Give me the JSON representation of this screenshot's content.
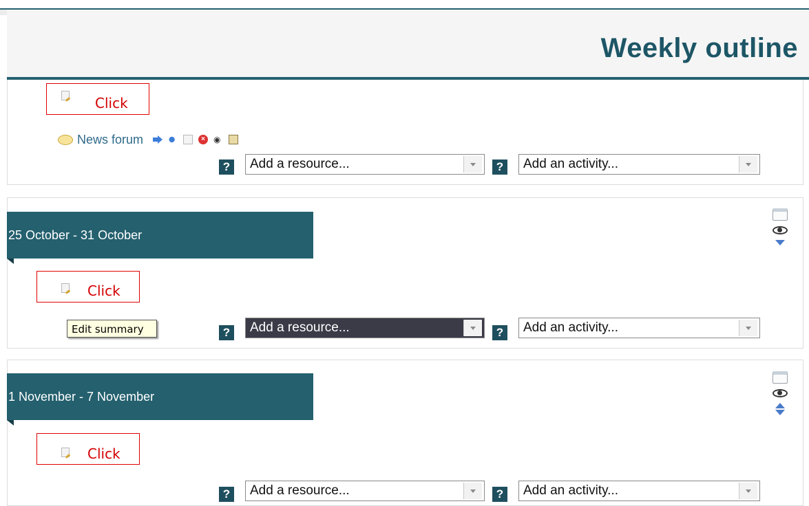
{
  "page": {
    "title": "Weekly outline"
  },
  "click_label": "Click",
  "news": {
    "label": "News forum"
  },
  "controls": {
    "help_symbol": "?",
    "resource_placeholder": "Add a resource...",
    "activity_placeholder": "Add an activity..."
  },
  "weeks": [
    {
      "label": "25 October - 31 October"
    },
    {
      "label": "1 November - 7 November"
    }
  ],
  "tooltip": {
    "text": "Edit summary"
  },
  "icons": {
    "news": [
      "forum-icon",
      "move-right-icon",
      "move-icon",
      "edit-icon",
      "delete-icon",
      "show-icon",
      "roles-icon"
    ],
    "section_side": [
      "collapse-section-icon",
      "hide-section-icon",
      "move-up-icon",
      "move-down-icon"
    ]
  },
  "colors": {
    "accent": "#24606e",
    "title": "#1d5666",
    "annotation": "#d40000",
    "focus": "#3b3b48"
  }
}
